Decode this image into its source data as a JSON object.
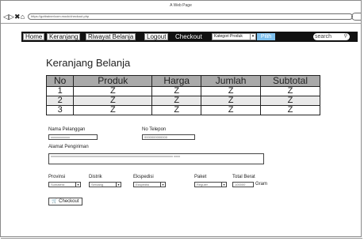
{
  "window": {
    "title": "A Web Page",
    "nav_back": "◁",
    "nav_forward": "▷",
    "nav_close": "✖",
    "nav_home": "⌂",
    "url": "https://gottrainer/com.mock/checkout.php"
  },
  "menu": {
    "home": "Home",
    "keranjang": "Keranjang",
    "riwayat": "Riwayat Belanja",
    "logout": "Logout",
    "checkout": "Checkout",
    "kategori": "Kategori Produk",
    "kategori_caret": "▾",
    "pilih": "Pilih",
    "search": "search",
    "search_icon": "⚲"
  },
  "page": {
    "title": "Keranjang Belanja"
  },
  "table": {
    "headers": [
      "No",
      "Produk",
      "Harga",
      "Jumlah",
      "Subtotal"
    ],
    "rows": [
      [
        "1",
        "Z",
        "Z",
        "Z",
        "Z"
      ],
      [
        "2",
        "Z",
        "Z",
        "Z",
        "Z"
      ],
      [
        "3",
        "Z",
        "Z",
        "Z",
        "Z"
      ]
    ]
  },
  "form": {
    "nama_label": "Nama Pelanggan",
    "nama_value": "xxxxxxxxxxxx",
    "telepon_label": "No Telepon",
    "telepon_value": "0000000000000",
    "alamat_label": "Alamat Pengiriman",
    "alamat_value": "xxxxxxxxxxxxxxxxxxxxxxxxxxxxxxxxxxxxxxxxxxxxxxxxxxxxxxxxxxxxxxxxxxxxxxxxxxxxx xxxx",
    "provinsi_label": "Provinsi",
    "provinsi_value": "Sumatera",
    "distrik_label": "Distrik",
    "distrik_value": "Serdang",
    "ekspedisi_label": "Ekspedisi",
    "ekspedisi_value": "Ekspedisi",
    "paket_label": "Paket",
    "paket_value": "Reguler",
    "berat_label": "Total Berat",
    "berat_value": "100000",
    "berat_unit": "Gram",
    "caret": "▾",
    "checkout_icon": "🛒",
    "checkout_label": "Checkout"
  }
}
